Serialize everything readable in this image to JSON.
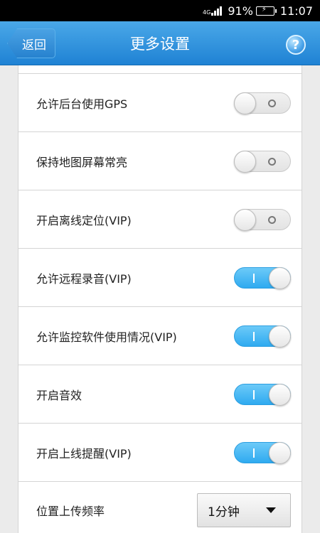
{
  "status_bar": {
    "network": "4G",
    "battery_percent": "91%",
    "time": "11:07"
  },
  "header": {
    "back_label": "返回",
    "title": "更多设置",
    "help_icon": "help-icon"
  },
  "settings": [
    {
      "label": "允许后台使用GPS",
      "state": "off"
    },
    {
      "label": "保持地图屏幕常亮",
      "state": "off"
    },
    {
      "label": "开启离线定位(VIP)",
      "state": "off"
    },
    {
      "label": "允许远程录音(VIP)",
      "state": "on"
    },
    {
      "label": "允许监控软件使用情况(VIP)",
      "state": "on"
    },
    {
      "label": "开启音效",
      "state": "on"
    },
    {
      "label": "开启上线提醒(VIP)",
      "state": "on"
    }
  ],
  "upload_frequency": {
    "label": "位置上传频率",
    "selected": "1分钟"
  },
  "colors": {
    "header": "#1f82d4",
    "toggle_on": "#2faaf0",
    "toggle_off": "#e3e3e3"
  }
}
